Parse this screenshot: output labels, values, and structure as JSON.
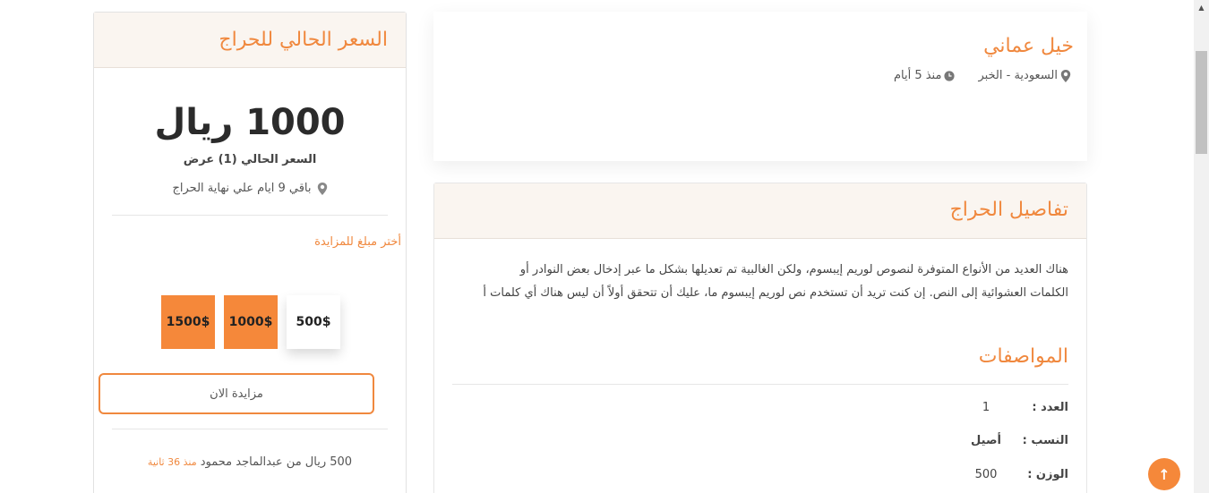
{
  "listing": {
    "title": "خيل عماني",
    "location": "السعودية - الخبر",
    "posted": "منذ 5 أيام"
  },
  "details": {
    "heading": "تفاصيل الحراج",
    "description": "هناك العديد من الأنواع المتوفرة لنصوص لوريم إيبسوم، ولكن الغالبية تم تعديلها بشكل ما عبر إدخال بعض النوادر أو\nالكلمات العشوائية إلى النص. إن كنت تريد أن تستخدم نص لوريم إيبسوم ما، عليك أن تتحقق أولاً أن ليس هناك أي كلمات أ",
    "specs_heading": "المواصفات",
    "specs": [
      {
        "label": "العدد :",
        "value": "1"
      },
      {
        "label": "النسب :",
        "value": "أصيل"
      },
      {
        "label": "الوزن :",
        "value": "500"
      }
    ]
  },
  "price_panel": {
    "heading": "السعر الحالي للحراج",
    "price": "1000 ريال",
    "subtitle": "السعر الحالي (1) عرض",
    "remaining": "باقي 9 ايام علي نهاية الحراج",
    "choose_label": "أختر مبلغ للمزايدة",
    "amounts": [
      "1500$",
      "1000$",
      "500$"
    ],
    "bid_button": "مزايدة الان",
    "last_bid": {
      "text": "500 ريال من عبدالماجد محمود",
      "time": "منذ 36 ثانية"
    }
  },
  "colors": {
    "accent": "#f0883e",
    "amount_fill": "#f5883a"
  },
  "icons": {
    "location": "map-pin-icon",
    "clock": "clock-icon",
    "to_top": "arrow-up-icon"
  }
}
